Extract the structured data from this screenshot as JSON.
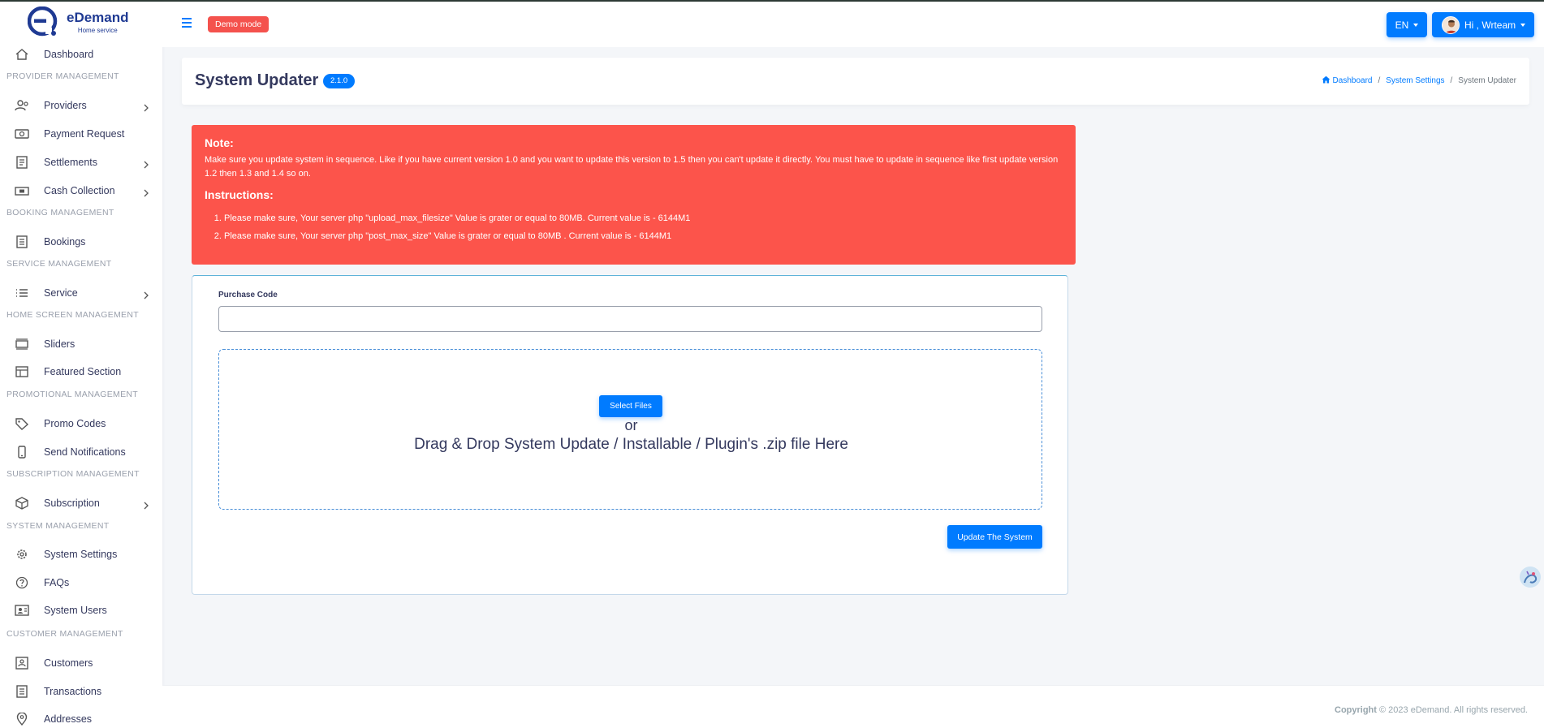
{
  "brand": {
    "name": "eDemand",
    "subtitle": "Home service",
    "color": "#1f3a93"
  },
  "sidebar": {
    "items": [
      {
        "label": "Dashboard",
        "icon": "home-icon"
      },
      {
        "section": "PROVIDER MANAGEMENT"
      },
      {
        "label": "Providers",
        "icon": "users-icon",
        "has_submenu": true
      },
      {
        "label": "Payment Request",
        "icon": "money-bill-icon"
      },
      {
        "label": "Settlements",
        "icon": "receipt-icon",
        "has_submenu": true
      },
      {
        "label": "Cash Collection",
        "icon": "cash-icon",
        "has_submenu": true
      },
      {
        "section": "BOOKING MANAGEMENT"
      },
      {
        "label": "Bookings",
        "icon": "list-alt-icon"
      },
      {
        "section": "SERVICE MANAGEMENT"
      },
      {
        "label": "Service",
        "icon": "list-icon",
        "has_submenu": true
      },
      {
        "section": "HOME SCREEN MANAGEMENT"
      },
      {
        "label": "Sliders",
        "icon": "sliders-icon"
      },
      {
        "label": "Featured Section",
        "icon": "layout-icon"
      },
      {
        "section": "PROMOTIONAL MANAGEMENT"
      },
      {
        "label": "Promo Codes",
        "icon": "tag-icon"
      },
      {
        "label": "Send Notifications",
        "icon": "mobile-icon"
      },
      {
        "section": "SUBSCRIPTION MANAGEMENT"
      },
      {
        "label": "Subscription",
        "icon": "cube-icon",
        "has_submenu": true
      },
      {
        "section": "SYSTEM MANAGEMENT"
      },
      {
        "label": "System Settings",
        "icon": "gear-icon"
      },
      {
        "label": "FAQs",
        "icon": "question-circle-icon"
      },
      {
        "label": "System Users",
        "icon": "id-card-icon"
      },
      {
        "section": "CUSTOMER MANAGEMENT"
      },
      {
        "label": "Customers",
        "icon": "user-box-icon"
      },
      {
        "label": "Transactions",
        "icon": "file-lines-icon"
      },
      {
        "label": "Addresses",
        "icon": "map-pin-icon"
      }
    ]
  },
  "navbar": {
    "demo_label": "Demo mode",
    "language_label": "EN",
    "user_label": "Hi , Wrteam"
  },
  "page": {
    "title": "System Updater",
    "version": "2.1.0",
    "breadcrumb": {
      "home": "Dashboard",
      "parent": "System Settings",
      "current": "System Updater"
    }
  },
  "alert": {
    "note_title": "Note:",
    "note_text": "Make sure you update system in sequence. Like if you have current version 1.0 and you want to update this version to 1.5 then you can't update it directly. You must have to update in sequence like first update version 1.2 then 1.3 and 1.4 so on.",
    "instructions_title": "Instructions:",
    "instructions": [
      "Please make sure, Your server php \"upload_max_filesize\" Value is grater or equal to 80MB. Current value is - 6144M1",
      "Please make sure, Your server php \"post_max_size\" Value is grater or equal to 80MB . Current value is - 6144M1"
    ],
    "color": "#fc544b"
  },
  "form": {
    "purchase_code_label": "Purchase Code",
    "purchase_code_value": "",
    "purchase_code_placeholder": "",
    "select_files_label": "Select Files",
    "or_text": "or",
    "dropzone_text": "Drag & Drop System Update / Installable / Plugin's .zip file Here",
    "update_button_label": "Update The System"
  },
  "footer": {
    "copyright_bold": "Copyright",
    "copyright_rest": " © 2023 eDemand. All rights reserved."
  },
  "colors": {
    "primary": "#007bff",
    "danger": "#fc544b",
    "demo_badge": "#f4524d"
  }
}
